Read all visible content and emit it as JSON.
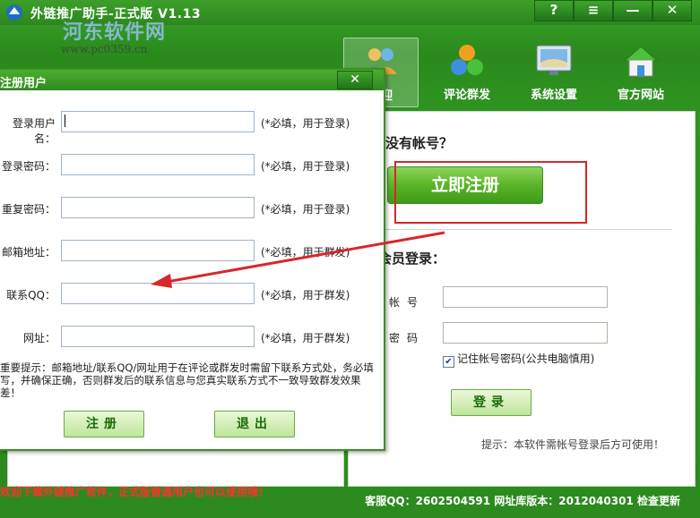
{
  "app": {
    "title": "外链推广助手-正式版  V1.13",
    "window_controls": {
      "help": "?",
      "menu": "≡",
      "minimize": "—",
      "close": "✕"
    },
    "watermark": {
      "line1": "河东软件网",
      "line2": "www.pc0359.cn"
    }
  },
  "nav": [
    {
      "label": "欢迎",
      "icon": "users-icon",
      "active": true
    },
    {
      "label": "评论群发",
      "icon": "colored-balls-icon",
      "active": false
    },
    {
      "label": "系统设置",
      "icon": "monitor-icon",
      "active": false
    },
    {
      "label": "官方网站",
      "icon": "house-icon",
      "active": false
    }
  ],
  "welcome_panel": {
    "no_account_text": "没有帐号？",
    "register_now_label": "立即注册",
    "member_login_heading": "会员登录：",
    "account_label": "帐号",
    "password_label": "密码",
    "remember_label": "记住帐号密码(公共电脑慎用)",
    "remember_checked": true,
    "login_button_label": "登录",
    "tip_text": "提示：本软件需帐号登录后方可使用！"
  },
  "status": {
    "left_text": "欢迎下载外链推广软件，正式版普通用户也可以使用哦！",
    "right_text": "客服QQ：2602504591 网址库版本：2012040301  检查更新"
  },
  "dialog": {
    "title": "注册用户",
    "close_label": "✕",
    "fields": [
      {
        "label": "登录用户名：",
        "hint": "(*必填，用于登录)",
        "value": ""
      },
      {
        "label": "登录密码：",
        "hint": "(*必填，用于登录)",
        "value": ""
      },
      {
        "label": "重复密码：",
        "hint": "(*必填，用于登录)",
        "value": ""
      },
      {
        "label": "邮箱地址：",
        "hint": "(*必填，用于群发)",
        "value": ""
      },
      {
        "label": "联系QQ：",
        "hint": "(*必填，用于群发)",
        "value": ""
      },
      {
        "label": "网址：",
        "hint": "(*必填，用于群发)",
        "value": ""
      }
    ],
    "note": "重要提示：邮箱地址/联系QQ/网址用于在评论或群发时需留下联系方式处，务必填写，并确保正确，否则群发后的联系信息与您真实联系方式不一致导致群发效果差！",
    "register_button_label": "注册",
    "exit_button_label": "退出"
  },
  "colors": {
    "app_green": "#2e8b1e",
    "highlight_red": "#d8262a"
  }
}
